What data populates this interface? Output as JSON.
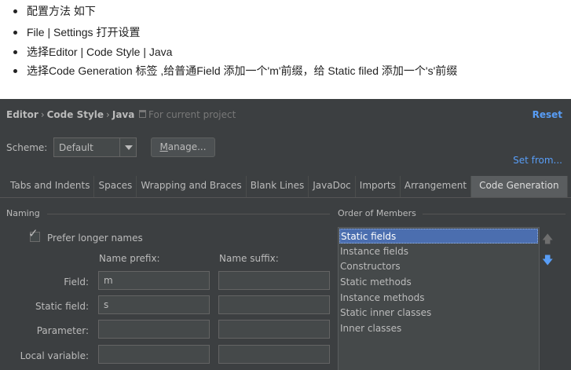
{
  "notes": [
    "配置方法 如下",
    "File | Settings 打开设置",
    "选择Editor | Code Style | Java",
    "选择Code Generation 标签 ,给普通Field 添加一个'm'前缀，给 Static filed 添加一个's'前缀"
  ],
  "header": {
    "crumbs": [
      "Editor",
      "Code Style",
      "Java"
    ],
    "crumb_sep": "›",
    "project_label": "For current project",
    "reset": "Reset"
  },
  "scheme": {
    "label": "Scheme:",
    "value": "Default",
    "manage_prefix": "",
    "manage_underlined": "M",
    "manage_rest": "anage...",
    "set_from": "Set from..."
  },
  "tabs": [
    "Tabs and Indents",
    "Spaces",
    "Wrapping and Braces",
    "Blank Lines",
    "JavaDoc",
    "Imports",
    "Arrangement",
    "Code Generation"
  ],
  "active_tab": "Code Generation",
  "naming": {
    "title": "Naming",
    "prefer_longer": "Prefer longer names",
    "prefer_checked": true,
    "prefix_header": "Name prefix:",
    "suffix_header": "Name suffix:",
    "rows": [
      {
        "label": "Field:",
        "prefix": "m",
        "suffix": ""
      },
      {
        "label": "Static field:",
        "prefix": "s",
        "suffix": ""
      },
      {
        "label": "Parameter:",
        "prefix": "",
        "suffix": ""
      },
      {
        "label": "Local variable:",
        "prefix": "",
        "suffix": ""
      }
    ]
  },
  "order": {
    "title": "Order of Members",
    "items": [
      "Static fields",
      "Instance fields",
      "Constructors",
      "Static methods",
      "Instance methods",
      "Static inner classes",
      "Inner classes"
    ],
    "selected": "Static fields"
  },
  "icons": {
    "checkbox_check": "check-icon",
    "up": "arrow-up-icon",
    "down": "arrow-down-icon",
    "project": "project-icon"
  },
  "colors": {
    "background": "#3c3f41",
    "link": "#589df6",
    "selection": "#4b6eaf"
  }
}
